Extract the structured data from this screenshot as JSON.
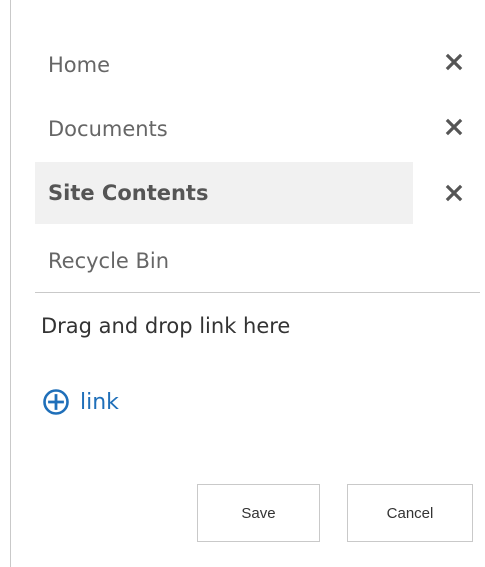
{
  "navigation": {
    "items": [
      {
        "label": "Home",
        "remove_icon": "close-icon"
      },
      {
        "label": "Documents",
        "remove_icon": "close-icon"
      },
      {
        "label": "Site Contents",
        "selected": true,
        "remove_icon": "close-icon"
      },
      {
        "label": "Recycle Bin"
      }
    ]
  },
  "drop_zone": {
    "text": "Drag and drop link here"
  },
  "add_link": {
    "icon": "plus-circle-icon",
    "label": "link"
  },
  "actions": {
    "save_label": "Save",
    "cancel_label": "Cancel"
  },
  "colors": {
    "selected_background": "#f1f1f1",
    "link_blue": "#1f6fb9",
    "divider": "#c9c9c9",
    "text": "#333333",
    "muted_text": "#666666"
  }
}
